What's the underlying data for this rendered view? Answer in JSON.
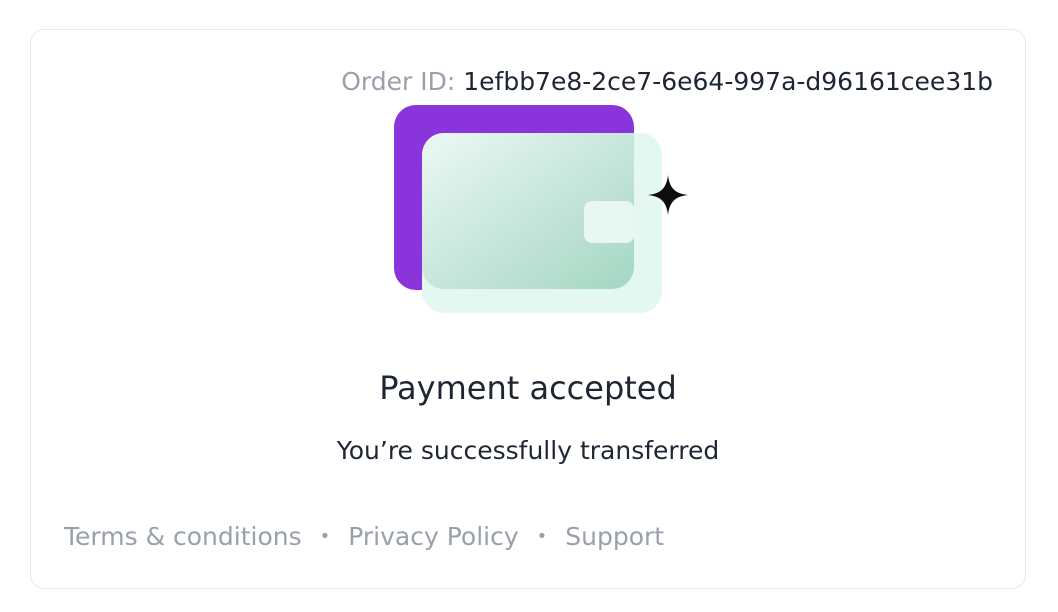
{
  "order": {
    "label": "Order ID:",
    "id": "1efbb7e8-2ce7-6e64-997a-d96161cee31b"
  },
  "illustration": {
    "icon": "wallet-icon",
    "sparkle_icon": "sparkle-icon",
    "colors": {
      "back_card": "#8a35dc",
      "front_card_light": "#e4f8f1",
      "front_card_gradient_top": "#e9f7f2",
      "front_card_gradient_bottom": "#a8d8c6",
      "sparkle": "#0d0d0d"
    }
  },
  "status": {
    "title": "Payment accepted",
    "subtitle": "You’re successfully transferred"
  },
  "footer": {
    "links": [
      {
        "label": "Terms & conditions"
      },
      {
        "label": "Privacy Policy"
      },
      {
        "label": "Support"
      }
    ],
    "separator": "•"
  },
  "colors": {
    "text_primary": "#1f2633",
    "text_muted": "#9aa0ab",
    "card_border": "#e6e8ec"
  }
}
